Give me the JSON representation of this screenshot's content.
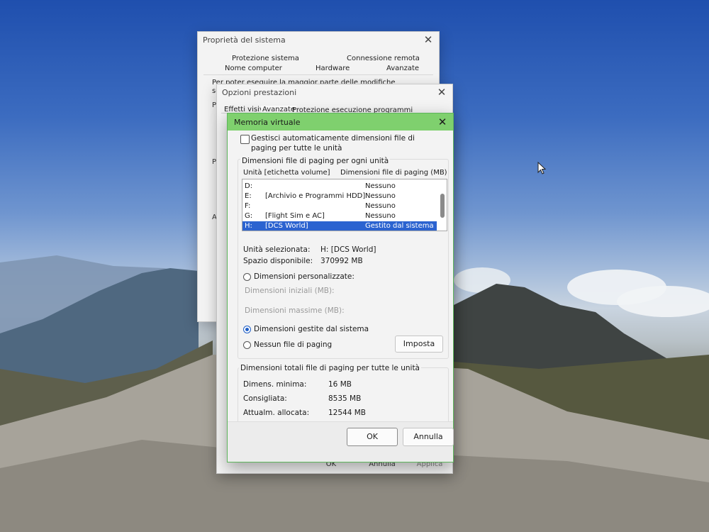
{
  "system_properties": {
    "title": "Proprietà del sistema",
    "tabs_row1": [
      "Protezione sistema",
      "Connessione remota"
    ],
    "tabs_row2": [
      "Nome computer",
      "Hardware",
      "Avanzate"
    ],
    "body_text": "Per poter eseguire la maggior parte delle modifiche seguenti, è necessario a",
    "side_letters": [
      "P",
      "P",
      "A"
    ]
  },
  "performance_options": {
    "title": "Opzioni prestazioni",
    "tabs": [
      "Effetti visivi",
      "Avanzate",
      "Protezione esecuzione programmi"
    ],
    "buttons": {
      "ok": "OK",
      "cancel": "Annulla",
      "apply": "Applica"
    }
  },
  "virtual_memory": {
    "title": "Memoria virtuale",
    "auto_manage_label": "Gestisci automaticamente dimensioni file di paging per tutte le unità",
    "auto_manage_checked": false,
    "group_title": "Dimensioni file di paging per ogni unità",
    "columns": [
      "Unità [etichetta volume]",
      "Dimensioni file di paging (MB)"
    ],
    "drives": [
      {
        "letter": "D:",
        "label": "",
        "size": "Nessuno"
      },
      {
        "letter": "E:",
        "label": "[Archivio e Programmi HDD]",
        "size": "Nessuno"
      },
      {
        "letter": "F:",
        "label": "",
        "size": "Nessuno"
      },
      {
        "letter": "G:",
        "label": "[Flight Sim e AC]",
        "size": "Nessuno"
      },
      {
        "letter": "H:",
        "label": "[DCS  World]",
        "size": "Gestito dal sistema",
        "selected": true
      }
    ],
    "selected_drive_label": "Unità selezionata:",
    "selected_drive_value": "H:  [DCS  World]",
    "free_space_label": "Spazio disponibile:",
    "free_space_value": "370992 MB",
    "custom_size_label": "Dimensioni personalizzate:",
    "initial_size_label": "Dimensioni iniziali (MB):",
    "max_size_label": "Dimensioni massime (MB):",
    "system_managed_label": "Dimensioni gestite dal sistema",
    "no_paging_label": "Nessun file di paging",
    "selected_option": "system_managed",
    "set_button": "Imposta",
    "totals_title": "Dimensioni totali file di paging per tutte le unità",
    "min_label": "Dimens. minima:",
    "min_value": "16 MB",
    "recommended_label": "Consigliata:",
    "recommended_value": "8535 MB",
    "allocated_label": "Attualm. allocata:",
    "allocated_value": "12544 MB",
    "ok_button": "OK",
    "cancel_button": "Annulla"
  },
  "colors": {
    "active_title_bar": "#7fd06e",
    "selection": "#2b63d0",
    "radio_accent": "#1f5fc7"
  }
}
